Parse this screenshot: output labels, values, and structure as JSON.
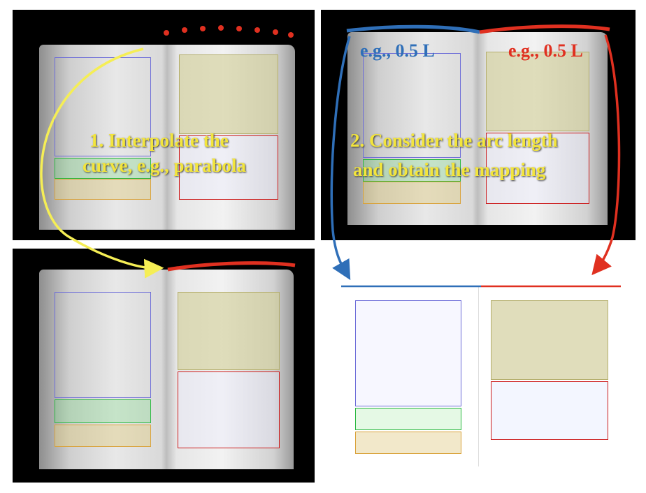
{
  "panels": {
    "top_left": {
      "caption_line1": "1. Interpolate the",
      "caption_line2": "curve, e.g., parabola"
    },
    "top_right": {
      "caption_line1": "2. Consider the arc length",
      "caption_line2": "and obtain the mapping",
      "left_label": "e.g., 0.5 L",
      "right_label": "e.g., 0.5 L"
    }
  },
  "colors": {
    "yellow_arrow": "#f5ee55",
    "red_curve": "#e03020",
    "blue_curve": "#2f6fb8",
    "caption": "#f3e53c",
    "box_blue": "#6c6cd8",
    "box_olive": "#d6d2a4",
    "box_green": "#2ab840",
    "box_red": "#cc1a1a"
  }
}
